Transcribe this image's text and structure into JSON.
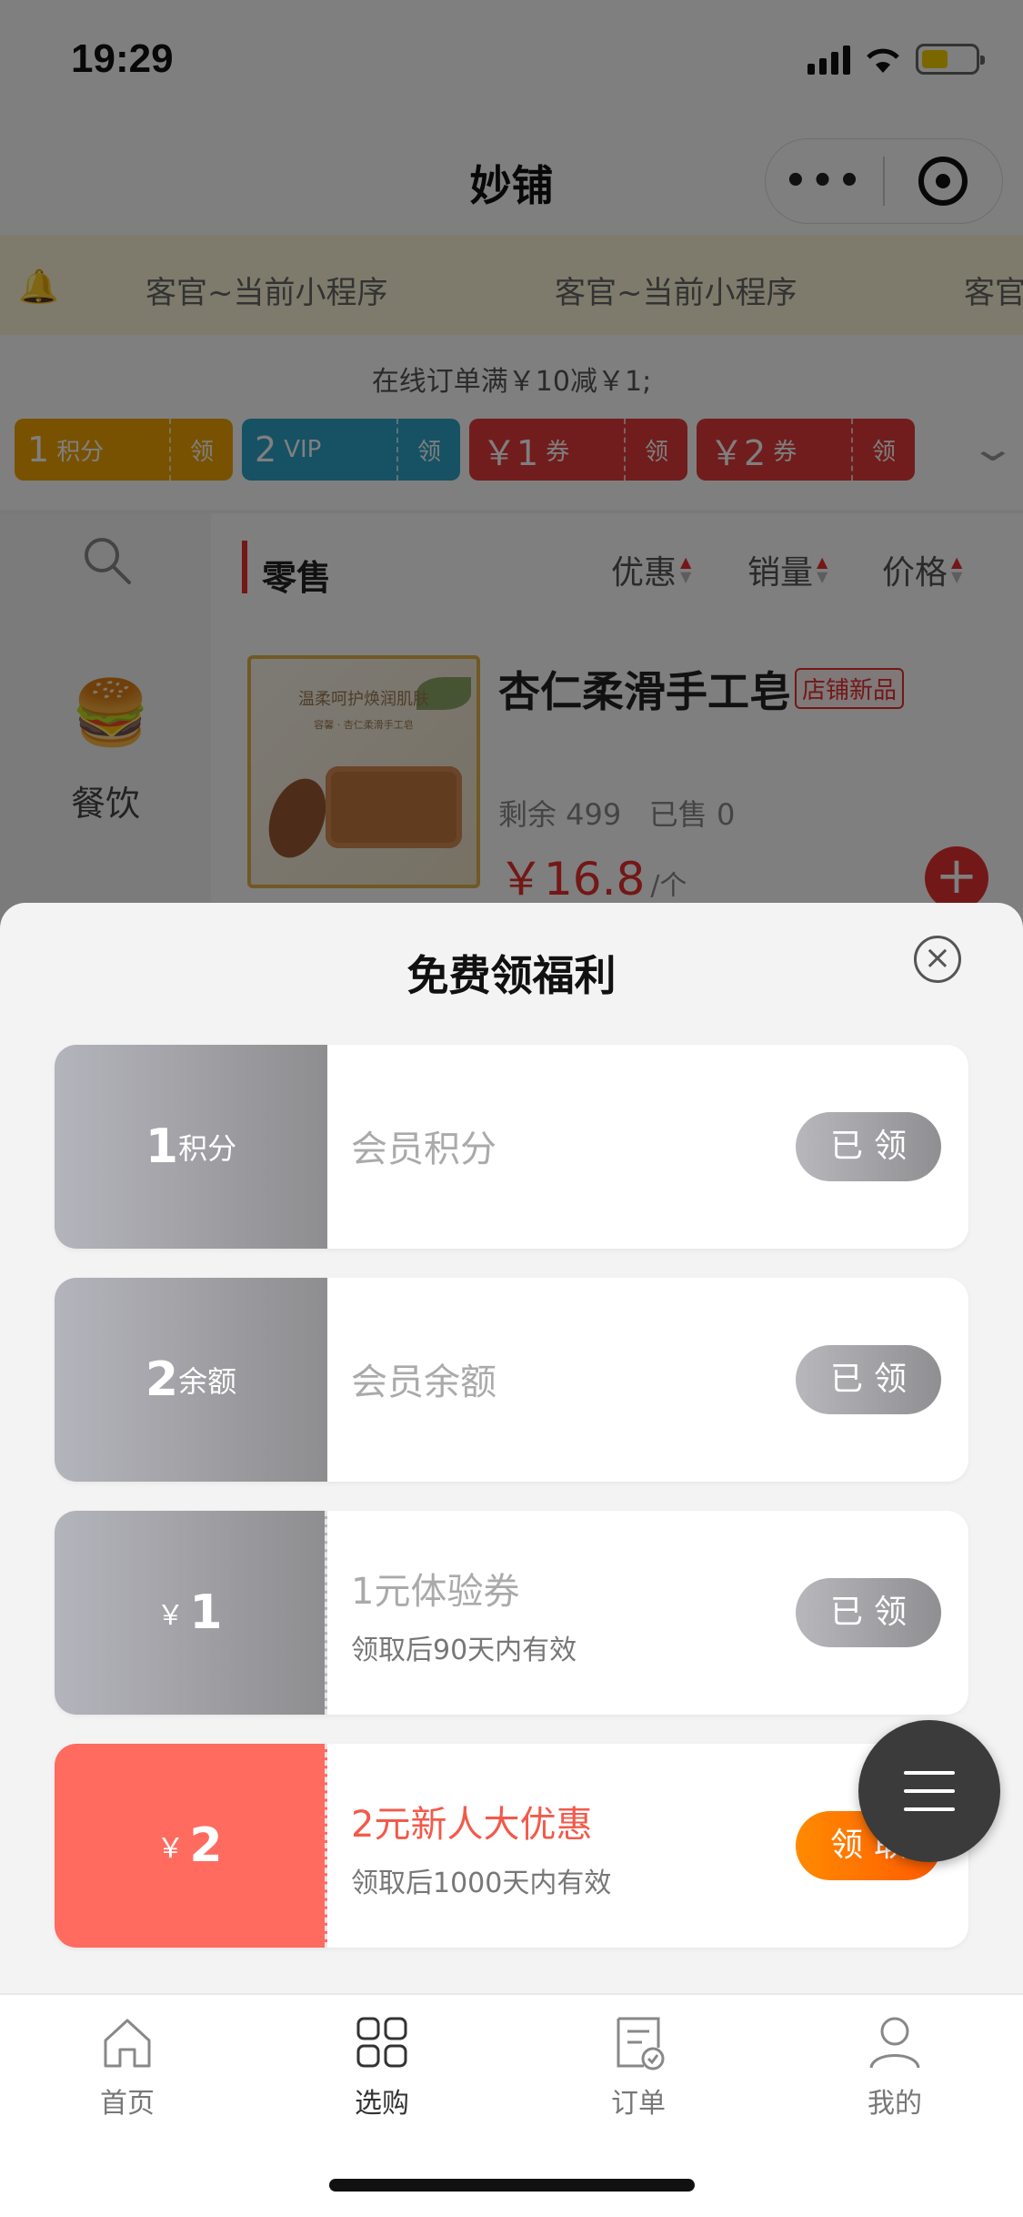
{
  "status": {
    "time": "19:29"
  },
  "nav": {
    "title": "妙铺",
    "more_label": "•••"
  },
  "marquee": {
    "items": [
      "客官~当前小程序",
      "客官~当前小程序",
      "客官"
    ]
  },
  "promo": {
    "text": "在线订单满￥10减￥1;",
    "chips": [
      {
        "value": "1",
        "unit": "积分",
        "action": "领",
        "color": "#f0a500"
      },
      {
        "value": "2",
        "unit": "VIP",
        "action": "领",
        "color": "#2fa3c8"
      },
      {
        "value": "￥1",
        "unit": "券",
        "action": "领",
        "color": "#e23b3b"
      },
      {
        "value": "￥2",
        "unit": "券",
        "action": "领",
        "color": "#e23b3b"
      }
    ]
  },
  "sidebar": {
    "category_label": "餐饮"
  },
  "main": {
    "section_title": "零售",
    "sort": [
      "优惠",
      "销量",
      "价格"
    ],
    "product": {
      "image_line1": "温柔呵护焕润肌肤",
      "image_line2": "容馨 · 杏仁柔滑手工皂",
      "name": "杏仁柔滑手工皂",
      "tag": "店铺新品",
      "remaining": "剩余 499",
      "sold": "已售 0",
      "price": "￥16.8",
      "unit": "/个"
    }
  },
  "sheet": {
    "title": "免费领福利",
    "cards": [
      {
        "stub_value": "1",
        "stub_unit": "积分",
        "title": "会员积分",
        "subtitle": "",
        "button": "已领",
        "claimed": true
      },
      {
        "stub_value": "2",
        "stub_unit": "余额",
        "title": "会员余额",
        "subtitle": "",
        "button": "已领",
        "claimed": true
      },
      {
        "stub_value": "1",
        "stub_unit": "￥",
        "title": "1元体验券",
        "subtitle": "领取后90天内有效",
        "button": "已领",
        "claimed": true
      },
      {
        "stub_value": "2",
        "stub_unit": "￥",
        "title": "2元新人大优惠",
        "subtitle": "领取后1000天内有效",
        "button": "领取",
        "claimed": false
      }
    ]
  },
  "tabbar": {
    "tabs": [
      {
        "label": "首页",
        "icon": "home-icon"
      },
      {
        "label": "选购",
        "icon": "grid-icon"
      },
      {
        "label": "订单",
        "icon": "order-icon"
      },
      {
        "label": "我的",
        "icon": "user-icon"
      }
    ],
    "active_index": 1
  }
}
